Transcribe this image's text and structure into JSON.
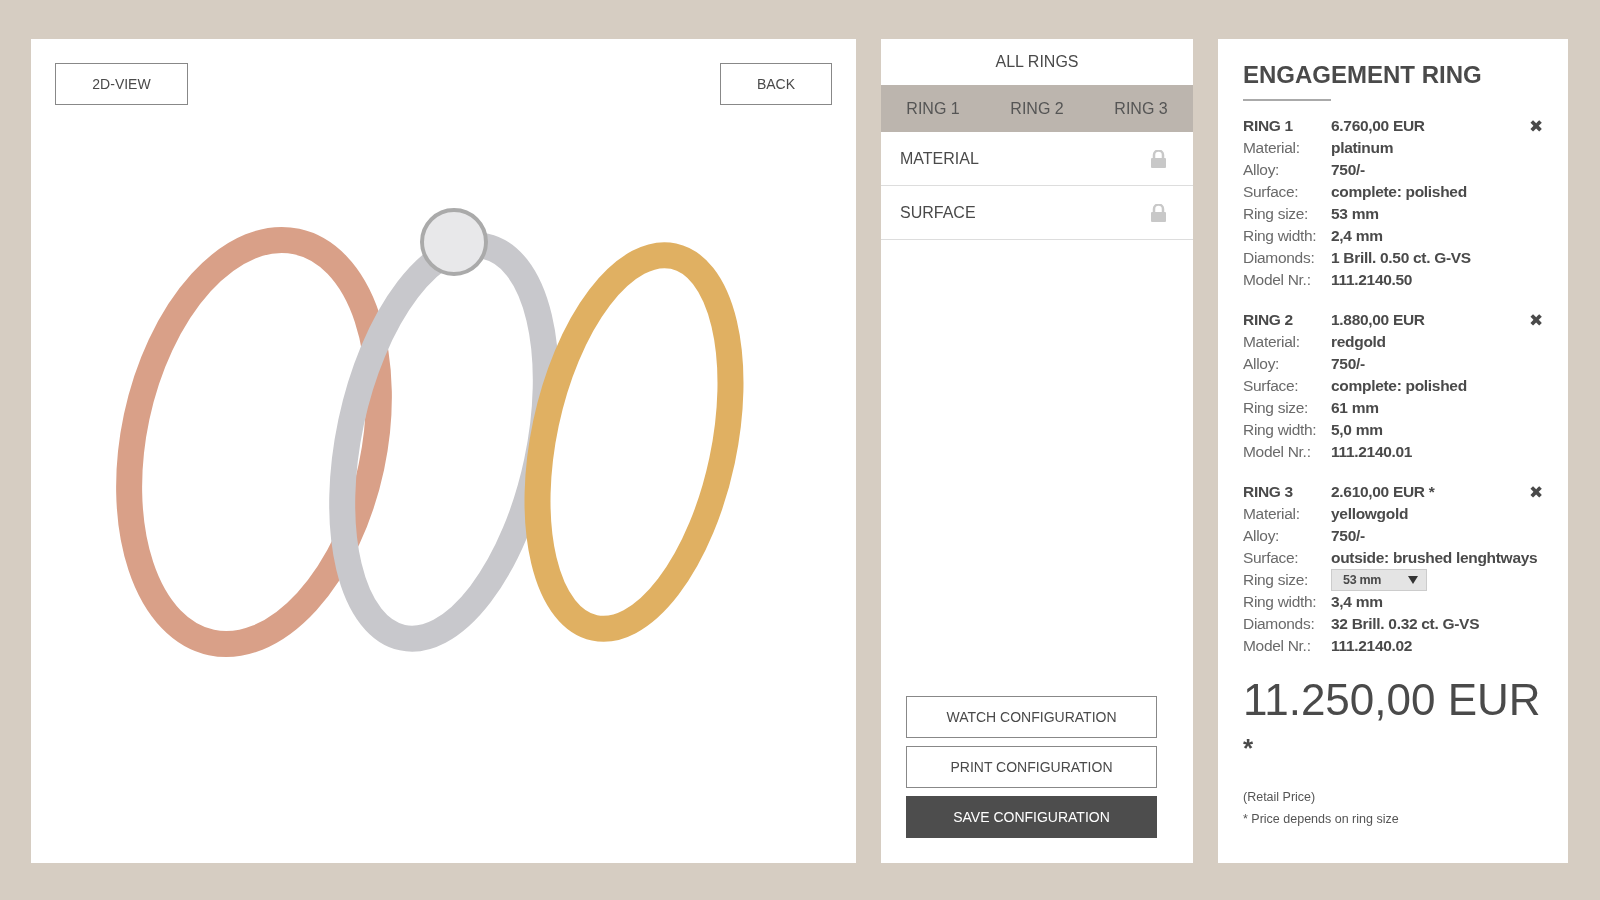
{
  "viewer": {
    "view_button": "2D-VIEW",
    "back_button": "BACK"
  },
  "configurator": {
    "title": "ALL RINGS",
    "tabs": [
      {
        "label": "RING 1",
        "selected": false
      },
      {
        "label": "RING 2",
        "selected": false
      },
      {
        "label": "RING 3",
        "selected": false
      }
    ],
    "options": [
      {
        "label": "MATERIAL",
        "locked": true
      },
      {
        "label": "SURFACE",
        "locked": true
      }
    ],
    "buttons": [
      {
        "label": "WATCH CONFIGURATION",
        "kind": "outline"
      },
      {
        "label": "PRINT CONFIGURATION",
        "kind": "outline"
      },
      {
        "label": "SAVE CONFIGURATION",
        "kind": "primary"
      }
    ]
  },
  "summary": {
    "title": "ENGAGEMENT RING",
    "rings": [
      {
        "name": "RING 1",
        "price": "6.760,00 EUR",
        "remove": "✖",
        "details": [
          {
            "label": "Material:",
            "value": "platinum",
            "kind": "text"
          },
          {
            "label": "Alloy:",
            "value": "750/-",
            "kind": "text"
          },
          {
            "label": "Surface:",
            "value": "complete: polished",
            "kind": "text"
          },
          {
            "label": "Ring size:",
            "value": "53 mm",
            "kind": "text"
          },
          {
            "label": "Ring width:",
            "value": "2,4 mm",
            "kind": "text"
          },
          {
            "label": "Diamonds:",
            "value": "1 Brill. 0.50 ct. G-VS",
            "kind": "text"
          },
          {
            "label": "Model Nr.:",
            "value": "111.2140.50",
            "kind": "text"
          }
        ]
      },
      {
        "name": "RING 2",
        "price": "1.880,00 EUR",
        "remove": "✖",
        "details": [
          {
            "label": "Material:",
            "value": "redgold",
            "kind": "text"
          },
          {
            "label": "Alloy:",
            "value": "750/-",
            "kind": "text"
          },
          {
            "label": "Surface:",
            "value": "complete: polished",
            "kind": "text"
          },
          {
            "label": "Ring size:",
            "value": "61 mm",
            "kind": "text"
          },
          {
            "label": "Ring width:",
            "value": "5,0 mm",
            "kind": "text"
          },
          {
            "label": "Model Nr.:",
            "value": "111.2140.01",
            "kind": "text"
          }
        ]
      },
      {
        "name": "RING 3",
        "price": "2.610,00 EUR *",
        "remove": "✖",
        "details": [
          {
            "label": "Material:",
            "value": "yellowgold",
            "kind": "text"
          },
          {
            "label": "Alloy:",
            "value": "750/-",
            "kind": "text"
          },
          {
            "label": "Surface:",
            "value": "outside: brushed lenghtways",
            "kind": "text"
          },
          {
            "label": "Ring size:",
            "value": "53 mm",
            "kind": "select"
          },
          {
            "label": "Ring width:",
            "value": "3,4 mm",
            "kind": "text"
          },
          {
            "label": "Diamonds:",
            "value": "32 Brill. 0.32 ct. G-VS",
            "kind": "text"
          },
          {
            "label": "Model Nr.:",
            "value": "111.2140.02",
            "kind": "text"
          }
        ]
      }
    ],
    "total": "11.250,00 EUR",
    "asterisk": "*",
    "retail_note": "(Retail Price)",
    "size_note": "* Price depends on ring size"
  }
}
